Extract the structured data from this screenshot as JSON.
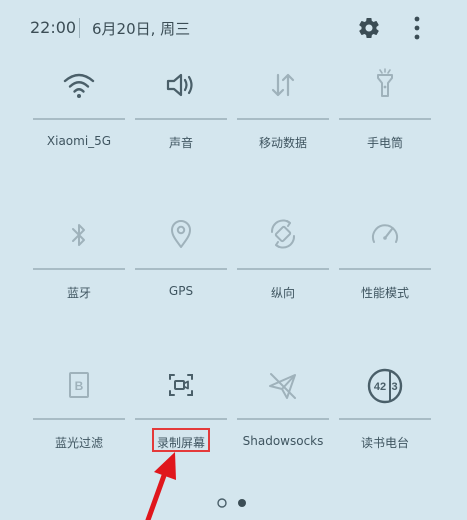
{
  "status_bar": {
    "time": "22:00",
    "date": "6月20日, 周三"
  },
  "icons": {
    "settings": "gear-icon",
    "more": "more-vertical-icon"
  },
  "tiles": [
    {
      "label": "Xiaomi_5G",
      "icon": "wifi-icon",
      "active": true
    },
    {
      "label": "声音",
      "icon": "speaker-icon",
      "active": true
    },
    {
      "label": "移动数据",
      "icon": "mobile-data-icon",
      "active": false
    },
    {
      "label": "手电筒",
      "icon": "flashlight-icon",
      "active": false
    },
    {
      "label": "蓝牙",
      "icon": "bluetooth-icon",
      "active": false
    },
    {
      "label": "GPS",
      "icon": "location-pin-icon",
      "active": false
    },
    {
      "label": "纵向",
      "icon": "rotation-icon",
      "active": false
    },
    {
      "label": "性能模式",
      "icon": "speedometer-icon",
      "active": false
    },
    {
      "label": "蓝光过滤",
      "icon": "blue-light-filter-icon",
      "active": false
    },
    {
      "label": "录制屏幕",
      "icon": "screen-record-icon",
      "active": false
    },
    {
      "label": "Shadowsocks",
      "icon": "paper-plane-icon",
      "active": false
    },
    {
      "label": "读书电台",
      "icon": "radio-423-icon",
      "active": true
    }
  ],
  "pagination": {
    "pages": 2,
    "current": 2
  },
  "colors": {
    "background": "#d4e6ee",
    "active_icon": "#4a5f69",
    "inactive_icon": "#9fb2bb",
    "highlight": "#e43a3a"
  }
}
